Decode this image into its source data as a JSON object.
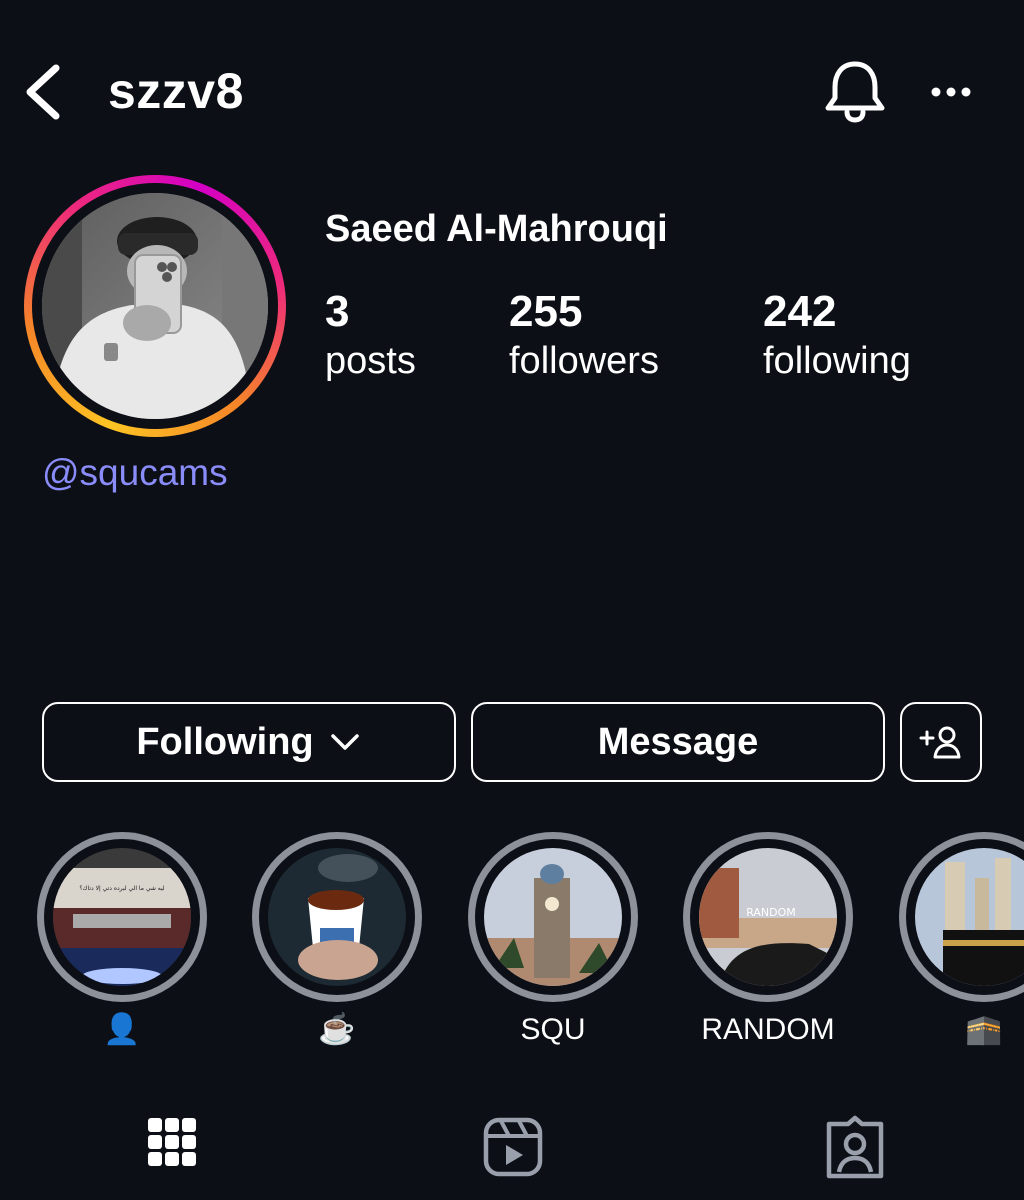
{
  "header": {
    "username": "szzv8",
    "back_icon": "chevron-left-icon",
    "notification_icon": "bell-icon",
    "more_icon": "more-horizontal-icon"
  },
  "profile": {
    "display_name": "Saeed Al-Mahrouqi",
    "handle": "@squcams",
    "stats": [
      {
        "value": "3",
        "label": "posts"
      },
      {
        "value": "255",
        "label": "followers"
      },
      {
        "value": "242",
        "label": "following"
      }
    ]
  },
  "actions": {
    "following_label": "Following",
    "message_label": "Message",
    "add_user_icon": "add-user-icon"
  },
  "highlights": [
    {
      "label": "👤"
    },
    {
      "label": "☕️"
    },
    {
      "label": "SQU"
    },
    {
      "label": "RANDOM",
      "overlay_text": "RANDOM"
    },
    {
      "label": "🕋"
    }
  ],
  "highlight_1_text": "ليه شي ما الي لبرده دتي إلا دتاك؟",
  "tabs": [
    "grid-icon",
    "reels-icon",
    "tagged-icon"
  ],
  "colors": {
    "background": "#0c0f16",
    "handle": "#8a8cf9",
    "highlight_ring": "#8d919a"
  }
}
